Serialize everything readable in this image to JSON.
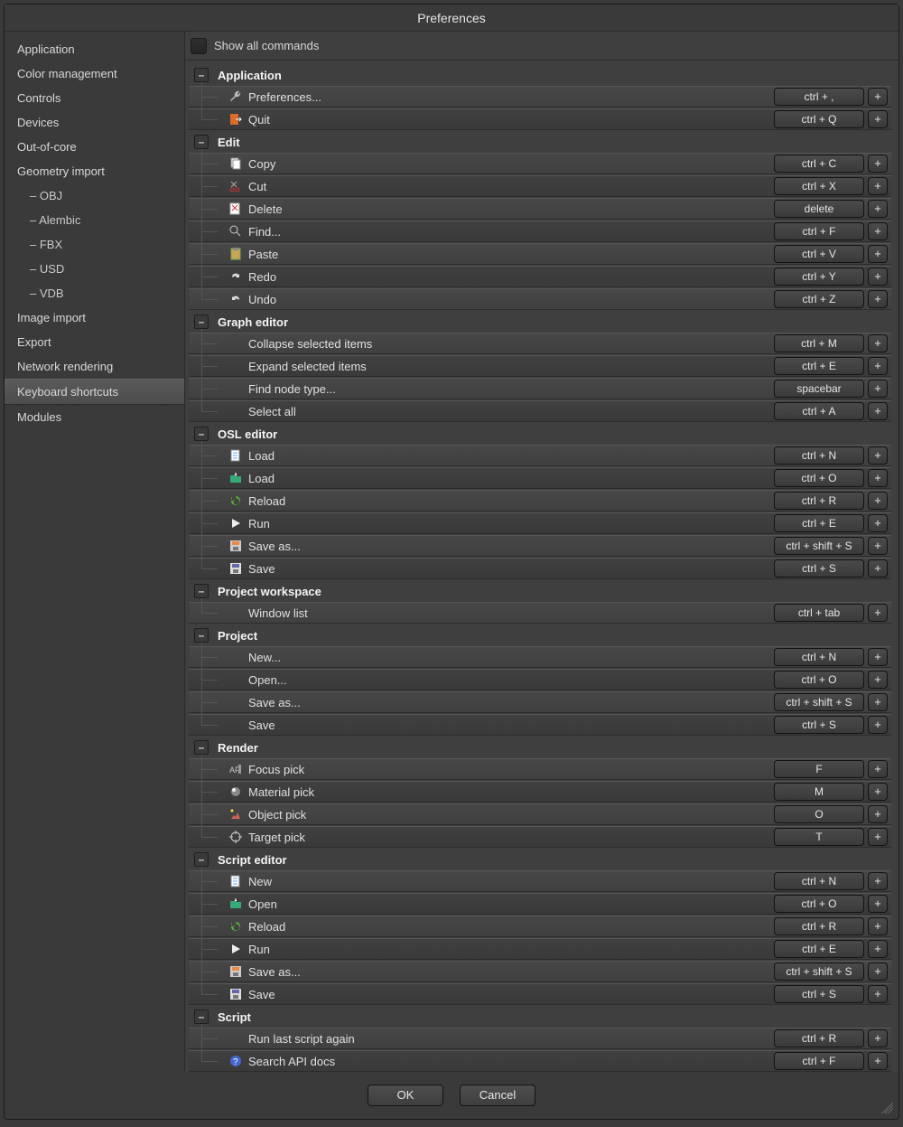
{
  "title": "Preferences",
  "show_all_commands_label": "Show all commands",
  "show_all_commands_checked": false,
  "sidebar": [
    {
      "label": "Application",
      "sub": false
    },
    {
      "label": "Color management",
      "sub": false
    },
    {
      "label": "Controls",
      "sub": false
    },
    {
      "label": "Devices",
      "sub": false
    },
    {
      "label": "Out-of-core",
      "sub": false
    },
    {
      "label": "Geometry import",
      "sub": false
    },
    {
      "label": "–  OBJ",
      "sub": true
    },
    {
      "label": "–  Alembic",
      "sub": true
    },
    {
      "label": "–  FBX",
      "sub": true
    },
    {
      "label": "–  USD",
      "sub": true
    },
    {
      "label": "–  VDB",
      "sub": true
    },
    {
      "label": "Image import",
      "sub": false
    },
    {
      "label": "Export",
      "sub": false
    },
    {
      "label": "Network rendering",
      "sub": false
    },
    {
      "label": "Keyboard shortcuts",
      "sub": false,
      "active": true
    },
    {
      "label": "Modules",
      "sub": false
    }
  ],
  "sections": [
    {
      "name": "Application",
      "items": [
        {
          "label": "Preferences...",
          "shortcut": "ctrl + ,",
          "icon": "wrench"
        },
        {
          "label": "Quit",
          "shortcut": "ctrl + Q",
          "icon": "exit"
        }
      ]
    },
    {
      "name": "Edit",
      "items": [
        {
          "label": "Copy",
          "shortcut": "ctrl + C",
          "icon": "copy"
        },
        {
          "label": "Cut",
          "shortcut": "ctrl + X",
          "icon": "cut"
        },
        {
          "label": "Delete",
          "shortcut": "delete",
          "icon": "delete"
        },
        {
          "label": "Find...",
          "shortcut": "ctrl + F",
          "icon": "search"
        },
        {
          "label": "Paste",
          "shortcut": "ctrl + V",
          "icon": "paste"
        },
        {
          "label": "Redo",
          "shortcut": "ctrl + Y",
          "icon": "redo"
        },
        {
          "label": "Undo",
          "shortcut": "ctrl + Z",
          "icon": "undo"
        }
      ]
    },
    {
      "name": "Graph editor",
      "items": [
        {
          "label": "Collapse selected items",
          "shortcut": "ctrl + M",
          "icon": ""
        },
        {
          "label": "Expand selected items",
          "shortcut": "ctrl + E",
          "icon": ""
        },
        {
          "label": "Find node type...",
          "shortcut": "spacebar",
          "icon": ""
        },
        {
          "label": "Select all",
          "shortcut": "ctrl + A",
          "icon": ""
        }
      ]
    },
    {
      "name": "OSL editor",
      "items": [
        {
          "label": "Load",
          "shortcut": "ctrl + N",
          "icon": "file-new"
        },
        {
          "label": "Load",
          "shortcut": "ctrl + O",
          "icon": "file-open"
        },
        {
          "label": "Reload",
          "shortcut": "ctrl + R",
          "icon": "reload"
        },
        {
          "label": "Run",
          "shortcut": "ctrl + E",
          "icon": "play"
        },
        {
          "label": "Save as...",
          "shortcut": "ctrl + shift + S",
          "icon": "saveas"
        },
        {
          "label": "Save",
          "shortcut": "ctrl + S",
          "icon": "save"
        }
      ]
    },
    {
      "name": "Project workspace",
      "items": [
        {
          "label": "Window list",
          "shortcut": "ctrl + tab",
          "icon": ""
        }
      ]
    },
    {
      "name": "Project",
      "items": [
        {
          "label": "New...",
          "shortcut": "ctrl + N",
          "icon": ""
        },
        {
          "label": "Open...",
          "shortcut": "ctrl + O",
          "icon": ""
        },
        {
          "label": "Save as...",
          "shortcut": "ctrl + shift + S",
          "icon": ""
        },
        {
          "label": "Save",
          "shortcut": "ctrl + S",
          "icon": ""
        }
      ]
    },
    {
      "name": "Render",
      "items": [
        {
          "label": "Focus pick",
          "shortcut": "F",
          "icon": "focus"
        },
        {
          "label": "Material pick",
          "shortcut": "M",
          "icon": "material"
        },
        {
          "label": "Object pick",
          "shortcut": "O",
          "icon": "object"
        },
        {
          "label": "Target pick",
          "shortcut": "T",
          "icon": "target"
        }
      ]
    },
    {
      "name": "Script editor",
      "items": [
        {
          "label": "New",
          "shortcut": "ctrl + N",
          "icon": "file-new"
        },
        {
          "label": "Open",
          "shortcut": "ctrl + O",
          "icon": "file-open"
        },
        {
          "label": "Reload",
          "shortcut": "ctrl + R",
          "icon": "reload"
        },
        {
          "label": "Run",
          "shortcut": "ctrl + E",
          "icon": "play"
        },
        {
          "label": "Save as...",
          "shortcut": "ctrl + shift + S",
          "icon": "saveas"
        },
        {
          "label": "Save",
          "shortcut": "ctrl + S",
          "icon": "save"
        }
      ]
    },
    {
      "name": "Script",
      "items": [
        {
          "label": "Run last script again",
          "shortcut": "ctrl + R",
          "icon": ""
        },
        {
          "label": "Search API docs",
          "shortcut": "ctrl + F",
          "icon": "help"
        }
      ]
    }
  ],
  "buttons": {
    "ok": "OK",
    "cancel": "Cancel",
    "plus": "+",
    "collapse": "–"
  }
}
